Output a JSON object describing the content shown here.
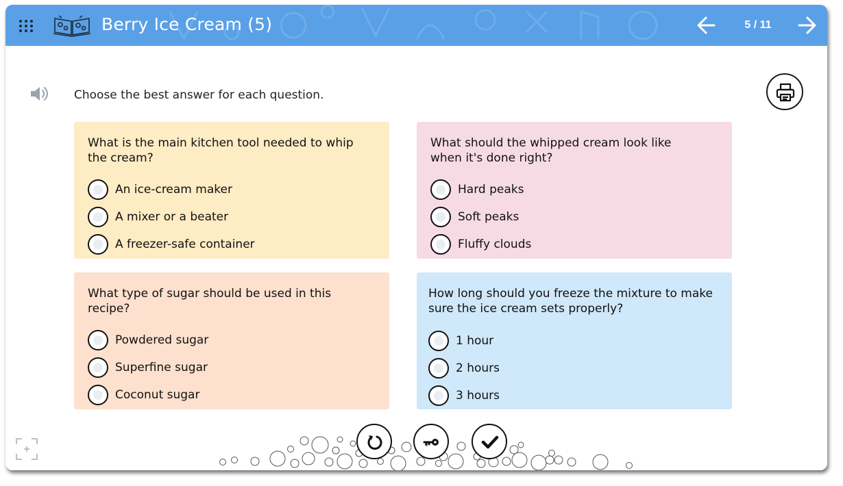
{
  "header": {
    "title": "Berry Ice Cream (5)",
    "page_counter": "5 / 11",
    "color": "#5aa0e6",
    "menu_icon": "grid-icon",
    "prev_icon": "arrow-left-icon",
    "next_icon": "arrow-right-icon"
  },
  "instructions": {
    "text": "Choose the best answer for each question."
  },
  "questions": [
    {
      "text": "What is the main kitchen tool needed to whip the cream?",
      "color": "#fdecc4",
      "options": [
        "An ice-cream maker",
        "A mixer or a beater",
        "A freezer-safe container"
      ]
    },
    {
      "text": "What should the whipped cream look like when it's done right?",
      "color": "#f7dbe4",
      "options": [
        "Hard peaks",
        "Soft peaks",
        "Fluffy clouds"
      ]
    },
    {
      "text": "What type of sugar should be used in this recipe?",
      "color": "#fde0cd",
      "options": [
        "Powdered sugar",
        "Superfine sugar",
        "Coconut sugar"
      ]
    },
    {
      "text": "How long should you freeze the mixture to make sure the ice cream sets properly?",
      "color": "#cfe8fa",
      "options": [
        "1 hour",
        "2 hours",
        "3 hours"
      ]
    }
  ],
  "controls": {
    "retry_icon": "retry-icon",
    "key_icon": "key-icon",
    "check_icon": "check-icon",
    "print_icon": "printer-icon",
    "speaker_icon": "speaker-icon",
    "fullscreen_icon": "fullscreen-icon"
  }
}
